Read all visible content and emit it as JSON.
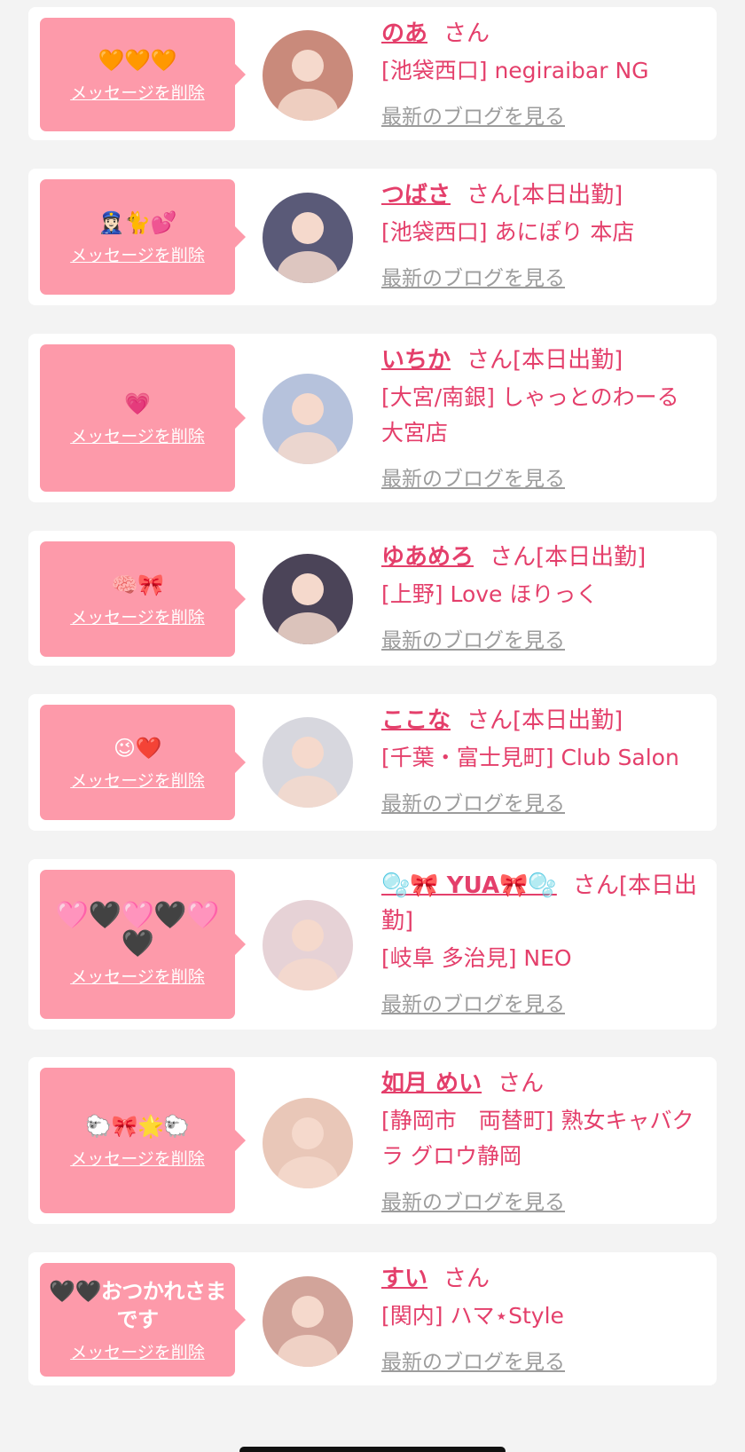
{
  "messages": [
    {
      "emoji": "🧡🧡🧡",
      "delete_label": "メッセージを削除",
      "name": "のあ",
      "suffix": "さん",
      "shop": "[池袋西口] negiraibar NG",
      "blog_label": "最新のブログを見る",
      "avatar_color": "#c98a7b"
    },
    {
      "emoji": "👮🏻‍♀️🐈💕",
      "delete_label": "メッセージを削除",
      "name": "つばさ",
      "suffix": "さん[本日出勤]",
      "shop": "[池袋西口] あにぽり 本店",
      "blog_label": "最新のブログを見る",
      "avatar_color": "#5a5a78"
    },
    {
      "emoji": "💗",
      "delete_label": "メッセージを削除",
      "name": "いちか",
      "suffix": "さん[本日出勤]",
      "shop": "[大宮/南銀] しゃっとのわーる大宮店",
      "blog_label": "最新のブログを見る",
      "avatar_color": "#b6c2dc"
    },
    {
      "emoji": "🧠🎀",
      "delete_label": "メッセージを削除",
      "name": "ゆあめろ",
      "suffix": "さん[本日出勤]",
      "shop": "[上野] Love ほりっく",
      "blog_label": "最新のブログを見る",
      "avatar_color": "#4b4458"
    },
    {
      "emoji": "😉❤️",
      "delete_label": "メッセージを削除",
      "name": "ここな",
      "suffix": "さん[本日出勤]",
      "shop": "[千葉・富士見町] Club Salon",
      "blog_label": "最新のブログを見る",
      "avatar_color": "#d7d7de"
    },
    {
      "emoji": "🩷🖤🩷🖤🩷🖤",
      "delete_label": "メッセージを削除",
      "name": "🫧🎀 YUA🎀🫧",
      "suffix": "さん[本日出勤]",
      "shop": "[岐阜 多治見] NEO",
      "blog_label": "最新のブログを見る",
      "avatar_color": "#e6d2d6"
    },
    {
      "emoji": "🐑🎀🌟🐑",
      "delete_label": "メッセージを削除",
      "name": "如月 めい",
      "suffix": "さん",
      "shop": "[静岡市　両替町] 熟女キャバクラ グロウ静岡",
      "blog_label": "最新のブログを見る",
      "avatar_color": "#e9c7b8"
    },
    {
      "emoji": "🖤🖤おつかれさまです",
      "delete_label": "メッセージを削除",
      "name": "すい",
      "suffix": "さん",
      "shop": "[関内] ハマ⋆Style",
      "blog_label": "最新のブログを見る",
      "avatar_color": "#d2a49a"
    }
  ],
  "colors": {
    "accent": "#e43f6b",
    "bubble": "#fd9aaa",
    "link_gray": "#9c9c9c"
  }
}
